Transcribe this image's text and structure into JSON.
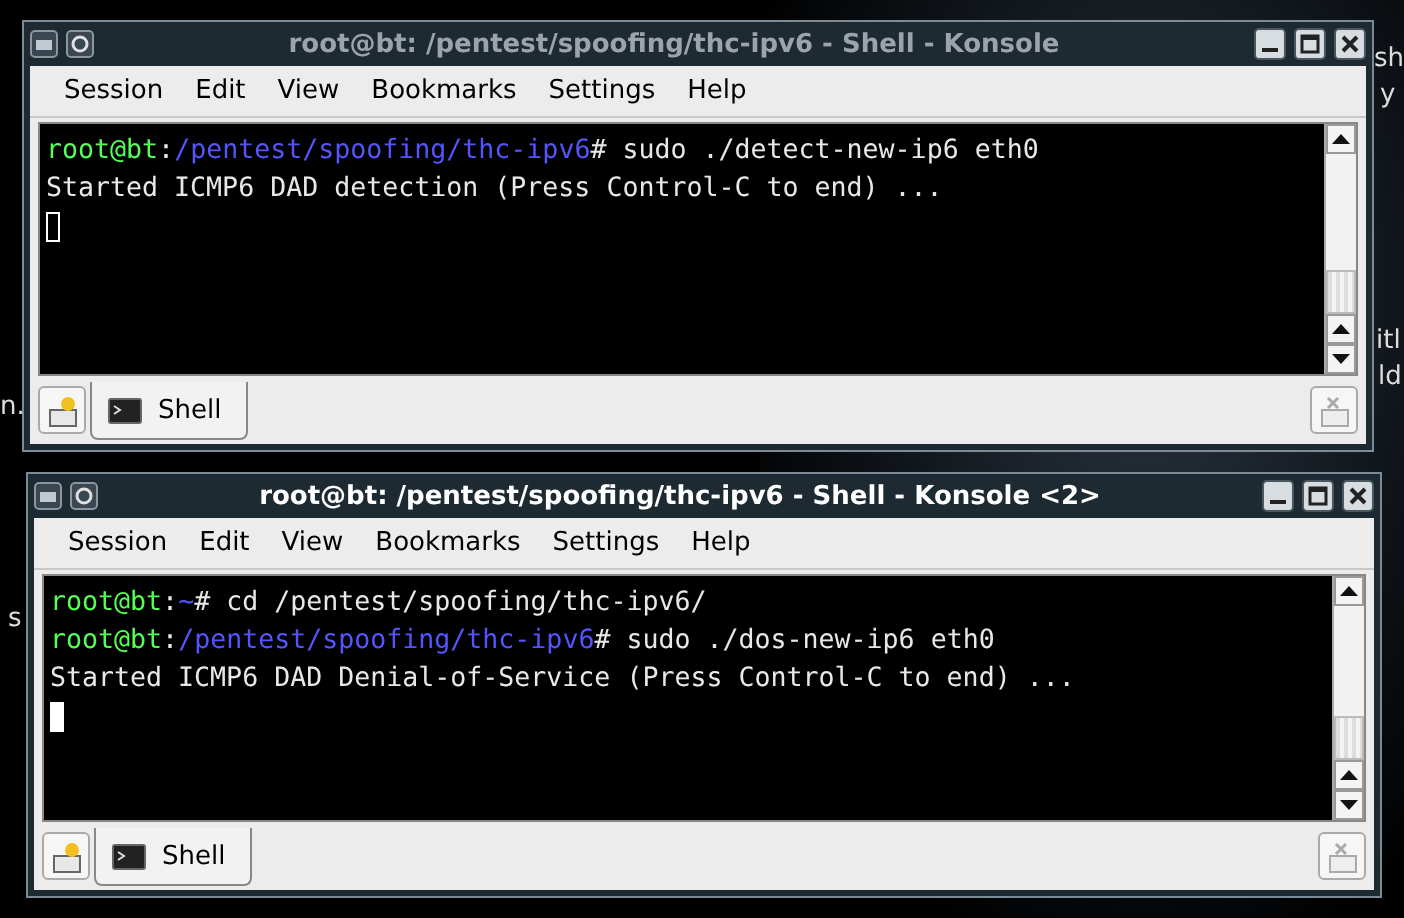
{
  "desktop": {
    "fragments": [
      {
        "text": "sh"
      },
      {
        "text": "y"
      },
      {
        "text": "itl"
      },
      {
        "text": "ld"
      },
      {
        "text": "n."
      },
      {
        "text": "s"
      }
    ]
  },
  "windows": [
    {
      "title": "root@bt: /pentest/spoofing/thc-ipv6 - Shell - Konsole",
      "active": false,
      "menu": [
        "Session",
        "Edit",
        "View",
        "Bookmarks",
        "Settings",
        "Help"
      ],
      "lines": [
        [
          {
            "kind": "user",
            "text": "root@bt"
          },
          {
            "kind": "text",
            "text": ":"
          },
          {
            "kind": "path",
            "text": "/pentest/spoofing/thc-ipv6"
          },
          {
            "kind": "text",
            "text": "# sudo ./detect-new-ip6 eth0"
          }
        ],
        [
          {
            "kind": "text",
            "text": "Started ICMP6 DAD detection (Press Control-C to end) ..."
          }
        ]
      ],
      "tabs": [
        {
          "label": "Shell",
          "selected": true
        }
      ]
    },
    {
      "title": "root@bt: /pentest/spoofing/thc-ipv6 - Shell - Konsole <2>",
      "active": true,
      "menu": [
        "Session",
        "Edit",
        "View",
        "Bookmarks",
        "Settings",
        "Help"
      ],
      "lines": [
        [
          {
            "kind": "user",
            "text": "root@bt"
          },
          {
            "kind": "text",
            "text": ":"
          },
          {
            "kind": "path",
            "text": "~"
          },
          {
            "kind": "text",
            "text": "# cd /pentest/spoofing/thc-ipv6/"
          }
        ],
        [
          {
            "kind": "user",
            "text": "root@bt"
          },
          {
            "kind": "text",
            "text": ":"
          },
          {
            "kind": "path",
            "text": "/pentest/spoofing/thc-ipv6"
          },
          {
            "kind": "text",
            "text": "# sudo ./dos-new-ip6 eth0"
          }
        ],
        [
          {
            "kind": "text",
            "text": "Started ICMP6 DAD Denial-of-Service (Press Control-C to end) ..."
          }
        ]
      ],
      "tabs": [
        {
          "label": "Shell",
          "selected": true
        }
      ]
    }
  ]
}
